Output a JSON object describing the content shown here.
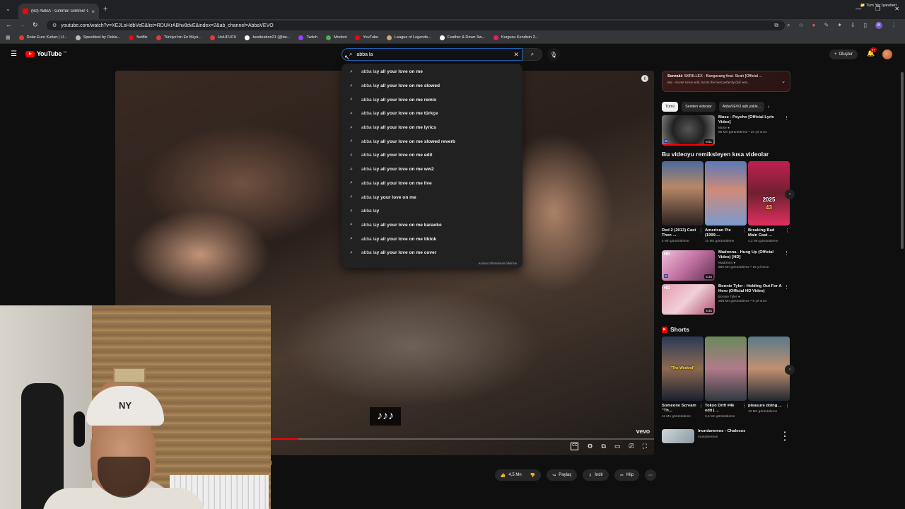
{
  "browser": {
    "tab_title": "(60) ABBA - Gimme! Gimme! G...",
    "url": "youtube.com/watch?v=XEJLoHdbVeE&list=RDUKrABhv8dvE&index=2&ab_channel=AbbaVEVO",
    "bookmarks": [
      {
        "label": "Dolar Euro Kurları | U...",
        "color": "#e53935"
      },
      {
        "label": "Speedtest by Ookla...",
        "color": "#bbbbbb"
      },
      {
        "label": "Netflix",
        "color": "#e50914"
      },
      {
        "label": "Türkiye'nin En Büyü...",
        "color": "#e53935"
      },
      {
        "label": "UwUFUFU",
        "color": "#e53935"
      },
      {
        "label": "bestteabon21 (@be...",
        "color": "#ffffff"
      },
      {
        "label": "Twitch",
        "color": "#9146ff"
      },
      {
        "label": "Moobot",
        "color": "#4caf50"
      },
      {
        "label": "YouTube",
        "color": "#ff0000"
      },
      {
        "label": "League of Legends...",
        "color": "#c8aa6e"
      },
      {
        "label": "Feather & Down Sw...",
        "color": "#ffffff"
      },
      {
        "label": "Kurgusu Kendisin 2...",
        "color": "#e91e63"
      }
    ],
    "all_bookmarks": "Tüm Yer İşaretleri"
  },
  "youtube": {
    "logo_word": "YouTube",
    "logo_country": "TR",
    "search": {
      "value": "abba la",
      "typed_prefix": "abba la",
      "suggestions": [
        {
          "typed": "abba la",
          "rest": "y all your love on me"
        },
        {
          "typed": "abba la",
          "rest": "y all your love on me slowed"
        },
        {
          "typed": "abba la",
          "rest": "y all your love on me remix"
        },
        {
          "typed": "abba la",
          "rest": "y all your love on me türkçe"
        },
        {
          "typed": "abba la",
          "rest": "y all your love on me lyrics"
        },
        {
          "typed": "abba la",
          "rest": "y all your love on me slowed reverb"
        },
        {
          "typed": "abba la",
          "rest": "y all your love on me edit"
        },
        {
          "typed": "abba la",
          "rest": "y all your love on me ww2"
        },
        {
          "typed": "abba la",
          "rest": "y all your love on me live"
        },
        {
          "typed": "abba la",
          "rest": "y your love on me"
        },
        {
          "typed": "abba la",
          "rest": "y"
        },
        {
          "typed": "abba la",
          "rest": "y all your love on me karaoke"
        },
        {
          "typed": "abba la",
          "rest": "y all your love on me tiktok"
        },
        {
          "typed": "abba la",
          "rest": "y all your love on me cover"
        }
      ],
      "report_text": "Arama tahminlerini bildirme"
    },
    "create_label": "Oluştur",
    "notif_count": "9+"
  },
  "player": {
    "caption_notes": "♪♪♪",
    "watermark": "vevo",
    "progress_fraction": 0.34
  },
  "actions": {
    "likes": "4,5 Mn",
    "share": "Paylaş",
    "download": "İndir",
    "clip": "Klip"
  },
  "sidebar": {
    "upnext_prefix": "Sonraki:",
    "upnext_title": " SKRILLEX - Bangarang feat. Sirah [Official ...",
    "upnext_sub": "Mix - Soviet Union edit, but its the best perfectly (full vers...",
    "chips": [
      "Tümü",
      "Seriden videolar",
      "AbbaVEVO adlı yükle..."
    ],
    "video1": {
      "title": "Muse - Psycho [Official Lyric Video]",
      "channel": "Muse ●",
      "stats": "85 Mn görüntüleme • 10 yıl önce",
      "duration": "5:51",
      "badge": "W"
    },
    "remix_title": "Bu videoyu remiksleyen kısa videolar",
    "remix_shorts": [
      {
        "title": "Red 2 (2013) Cast Then ...",
        "views": "4 Mn görüntüleme",
        "overlay": ""
      },
      {
        "title": "American Pie (1999-...",
        "views": "10 Mn görüntüleme",
        "overlay": ""
      },
      {
        "title": "Breaking Bad Main Cast ...",
        "views": "4,2 Mn görüntüleme",
        "overlay": "2025",
        "overlay2": "43"
      }
    ],
    "video2": {
      "title": "Madonna - Hung Up (Official Video) [HD]",
      "channel": "Madonna ●",
      "stats": "550 Mn görüntüleme • 15 yıl önce",
      "duration": "5:34",
      "badge": "W",
      "hd": "HD"
    },
    "video3": {
      "title": "Bonnie Tyler - Holding Out For A Hero (Official HD Video)",
      "channel": "Bonnie Tyler ●",
      "stats": "268 Mn görüntüleme • 9 yıl önce",
      "duration": "4:45",
      "hd": "HD"
    },
    "shorts_title": "Shorts",
    "shorts": [
      {
        "title": "Someone Scream \"Th...",
        "views": "11 Mn görüntüleme",
        "overlay": "\"The Weeknd\""
      },
      {
        "title": "Tokyo Drift #4k edit | ...",
        "views": "3,4 Mn görüntüleme",
        "overlay": ""
      },
      {
        "title": "pleasure doing ...",
        "views": "12 Mn görüntüleme",
        "overlay": ""
      }
    ],
    "video4": {
      "title": "Inundaremos - Chalecos",
      "channel": "Inundaremos"
    }
  },
  "colors": {
    "accent_red": "#ff0000",
    "focus_blue": "#1c62b9",
    "bg": "#0f0f0f"
  }
}
